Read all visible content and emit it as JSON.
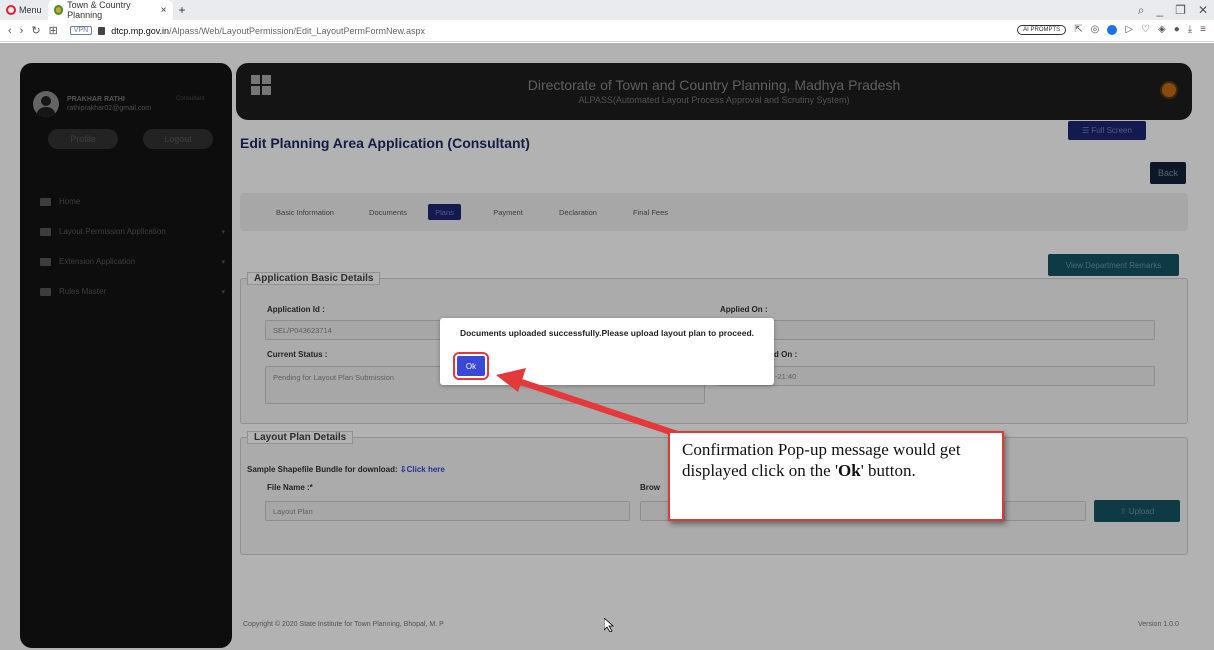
{
  "browser": {
    "menu_label": "Menu",
    "tab_title": "Town & Country Planning",
    "tab_close": "×",
    "new_tab": "+",
    "vpn": "VPN",
    "url_host": "dtcp.mp.gov.in",
    "url_path": "/Alpass/Web/LayoutPermission/Edit_LayoutPermFormNew.aspx",
    "ai_prompts": "AI PROMPTS"
  },
  "sidebar": {
    "user_name": "PRAKHAR RATHI",
    "user_email": "rathiprakhar02@gmail.com",
    "user_role": "Consultant",
    "profile_btn": "Profile",
    "logout_btn": "Logout",
    "items": [
      {
        "label": "Home"
      },
      {
        "label": "Layout Permission Application"
      },
      {
        "label": "Extension Application"
      },
      {
        "label": "Rules Master"
      }
    ]
  },
  "header": {
    "title": "Directorate of Town and Country Planning, Madhya Pradesh",
    "subtitle": "ALPASS(Automated Layout Process Approval and Scrutiny System)"
  },
  "toolbar": {
    "full_screen": "☰ Full Screen",
    "back": "Back"
  },
  "page_title": "Edit Planning Area Application (Consultant)",
  "tabs": [
    {
      "label": "Basic Information"
    },
    {
      "label": "Documents"
    },
    {
      "label": "Plans",
      "selected": true
    },
    {
      "label": "Payment"
    },
    {
      "label": "Declaration"
    },
    {
      "label": "Final Fees"
    }
  ],
  "view_remarks": "View Department Remarks",
  "basic_details": {
    "legend": "Application Basic Details",
    "app_id_label": "Application Id :",
    "app_id_value": "SEL/P043623714",
    "applied_on_label": "Applied On :",
    "status_label": "Current Status :",
    "status_value": "Pending for Layout Plan Submission",
    "updated_on_label": "d On :",
    "updated_on_value": "-21:40"
  },
  "layout_plan": {
    "legend": "Layout Plan Details",
    "sample_label": "Sample Shapefile Bundle for download:",
    "sample_link": "⇩Click here",
    "file_name_label": "File Name :*",
    "file_name_value": "Layout Plan",
    "browse_label": "Brow",
    "upload": "⇧ Upload"
  },
  "footer": {
    "copyright": "Copyright © 2020 State Institute for Town Planning, Bhopal, M. P",
    "version": "Version 1.0.0"
  },
  "modal": {
    "message": "Documents uploaded successfully.Please upload layout plan to proceed.",
    "ok": "Ok"
  },
  "callout": {
    "text_before": "Confirmation Pop-up message would get displayed click on the '",
    "bold": "Ok",
    "text_after": "' button."
  },
  "colors": {
    "accent_red": "#e5383b",
    "ok_blue": "#3a48d8",
    "nav_dark_blue": "#1b2672",
    "teal": "#155464"
  }
}
